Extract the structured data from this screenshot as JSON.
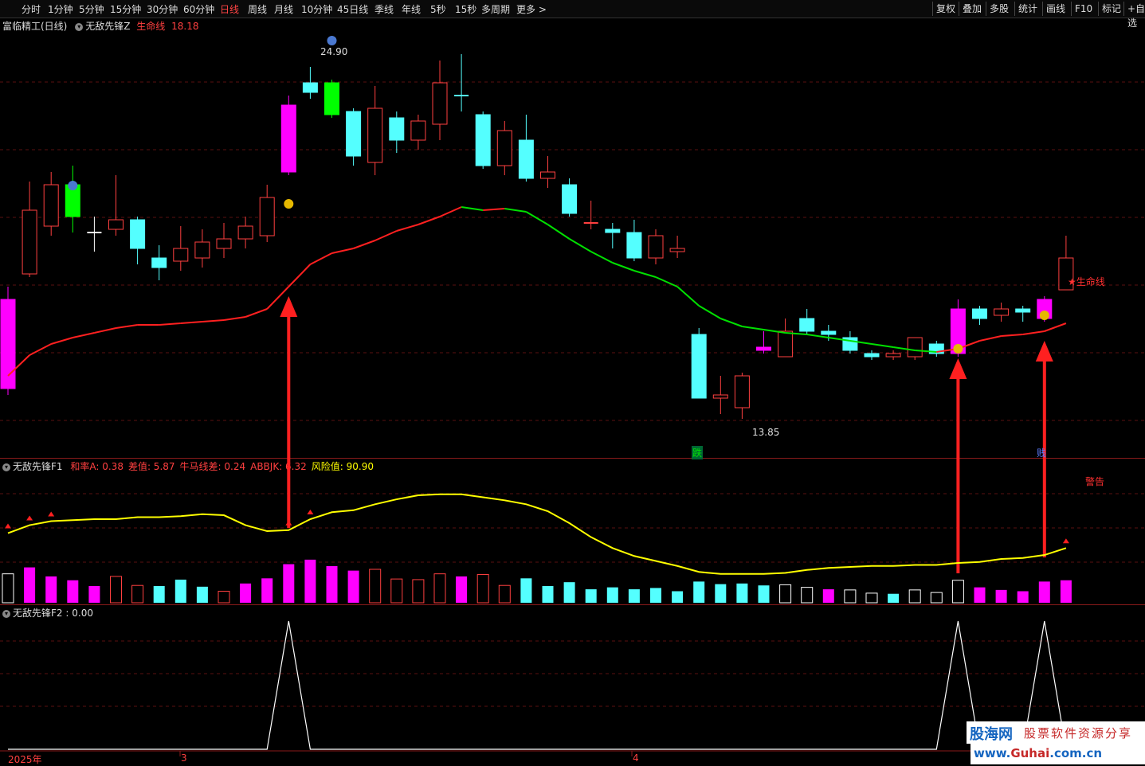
{
  "toolbar": {
    "periods": [
      "分时",
      "1分钟",
      "5分钟",
      "15分钟",
      "30分钟",
      "60分钟",
      "日线",
      "周线",
      "月线",
      "10分钟",
      "45日线",
      "季线",
      "年线",
      "5秒",
      "15秒",
      "多周期",
      "更多 >"
    ],
    "active_period": "日线",
    "right_buttons": [
      "复权",
      "叠加",
      "多股",
      "统计",
      "画线",
      "F10",
      "标记",
      "+自选"
    ]
  },
  "main_panel": {
    "stock_name": "富临精工(日线)",
    "indicator": "无敌先锋Z",
    "line_label": "生命线",
    "line_value": "18.18",
    "high_label": "24.90",
    "low_label": "13.85",
    "life_line_tag": "★生命线",
    "die_label": "跌",
    "jian_label": "贱",
    "warning_label": "警告"
  },
  "f1_panel": {
    "indicator": "无敌先锋F1",
    "items": [
      {
        "name": "和率A",
        "value": "0.38",
        "color": "#ff4040"
      },
      {
        "name": "差值",
        "value": "5.87",
        "color": "#ff4040"
      },
      {
        "name": "牛马线差",
        "value": "0.24",
        "color": "#ff4040"
      },
      {
        "name": "ABBJK",
        "value": "6.32",
        "color": "#ff4040"
      },
      {
        "name": "风险值",
        "value": "90.90",
        "color": "#ffff00"
      }
    ]
  },
  "f2_panel": {
    "indicator": "无敌先锋F2",
    "value": "0.00"
  },
  "x_axis": {
    "labels": [
      "2025年",
      "3",
      "4"
    ]
  },
  "watermark": {
    "site": "股海网",
    "slogan": "股票软件资源分享",
    "url_prefix": "www.",
    "url_main": "Guhai",
    "url_suffix": ".com.cn"
  },
  "colors": {
    "up": "#ff4040",
    "down": "#54ffff",
    "magenta": "#ff00ff",
    "green_candle": "#00ff00",
    "lifeline_up": "#ff2020",
    "lifeline_down": "#00e000",
    "yellow": "#ffff00"
  },
  "chart_data": {
    "type": "candlestick",
    "candles": [
      {
        "o": 14.8,
        "c": 17.6,
        "h": 18.0,
        "l": 14.6,
        "k": "magenta"
      },
      {
        "o": 18.4,
        "c": 20.4,
        "h": 21.3,
        "l": 18.3,
        "k": "up"
      },
      {
        "o": 19.9,
        "c": 21.2,
        "h": 21.6,
        "l": 19.6,
        "k": "up"
      },
      {
        "o": 21.2,
        "c": 20.2,
        "h": 21.8,
        "l": 19.7,
        "k": "green"
      },
      {
        "o": 19.7,
        "c": 19.7,
        "h": 20.2,
        "l": 19.1,
        "k": "doji"
      },
      {
        "o": 19.8,
        "c": 20.1,
        "h": 21.5,
        "l": 19.6,
        "k": "up"
      },
      {
        "o": 20.1,
        "c": 19.2,
        "h": 20.2,
        "l": 18.7,
        "k": "down"
      },
      {
        "o": 18.6,
        "c": 18.9,
        "h": 19.3,
        "l": 18.2,
        "k": "down"
      },
      {
        "o": 18.8,
        "c": 19.2,
        "h": 19.9,
        "l": 18.5,
        "k": "up"
      },
      {
        "o": 18.9,
        "c": 19.4,
        "h": 19.8,
        "l": 18.6,
        "k": "up"
      },
      {
        "o": 19.2,
        "c": 19.5,
        "h": 20.0,
        "l": 18.9,
        "k": "up"
      },
      {
        "o": 19.5,
        "c": 19.9,
        "h": 20.2,
        "l": 19.2,
        "k": "up"
      },
      {
        "o": 19.6,
        "c": 20.8,
        "h": 21.2,
        "l": 19.4,
        "k": "up"
      },
      {
        "o": 21.6,
        "c": 23.7,
        "h": 24.0,
        "l": 21.5,
        "k": "magenta"
      },
      {
        "o": 24.1,
        "c": 24.4,
        "h": 24.9,
        "l": 23.9,
        "k": "down"
      },
      {
        "o": 24.4,
        "c": 23.4,
        "h": 24.5,
        "l": 23.3,
        "k": "green"
      },
      {
        "o": 23.5,
        "c": 22.1,
        "h": 23.6,
        "l": 21.8,
        "k": "down"
      },
      {
        "o": 21.9,
        "c": 23.6,
        "h": 24.3,
        "l": 21.5,
        "k": "up"
      },
      {
        "o": 23.3,
        "c": 22.6,
        "h": 23.5,
        "l": 22.2,
        "k": "down"
      },
      {
        "o": 22.6,
        "c": 23.2,
        "h": 23.4,
        "l": 22.3,
        "k": "up"
      },
      {
        "o": 23.1,
        "c": 24.4,
        "h": 25.1,
        "l": 22.6,
        "k": "up"
      },
      {
        "o": 24.0,
        "c": 24.0,
        "h": 25.3,
        "l": 23.5,
        "k": "dojiC"
      },
      {
        "o": 23.4,
        "c": 21.8,
        "h": 23.5,
        "l": 21.7,
        "k": "down"
      },
      {
        "o": 21.8,
        "c": 22.9,
        "h": 23.2,
        "l": 21.5,
        "k": "up"
      },
      {
        "o": 22.6,
        "c": 21.4,
        "h": 23.4,
        "l": 21.3,
        "k": "down"
      },
      {
        "o": 21.4,
        "c": 21.6,
        "h": 22.1,
        "l": 21.1,
        "k": "up"
      },
      {
        "o": 21.2,
        "c": 20.3,
        "h": 21.4,
        "l": 20.2,
        "k": "down"
      },
      {
        "o": 20.0,
        "c": 20.0,
        "h": 20.7,
        "l": 19.8,
        "k": "dojiR"
      },
      {
        "o": 19.8,
        "c": 19.7,
        "h": 20.0,
        "l": 19.2,
        "k": "down"
      },
      {
        "o": 19.7,
        "c": 18.9,
        "h": 20.1,
        "l": 18.8,
        "k": "down"
      },
      {
        "o": 18.9,
        "c": 19.6,
        "h": 19.8,
        "l": 18.7,
        "k": "up"
      },
      {
        "o": 19.1,
        "c": 19.2,
        "h": 19.6,
        "l": 18.9,
        "k": "up"
      },
      {
        "o": 16.5,
        "c": 14.5,
        "h": 16.7,
        "l": 14.5,
        "k": "down"
      },
      {
        "o": 14.5,
        "c": 14.6,
        "h": 15.2,
        "l": 14.0,
        "k": "up"
      },
      {
        "o": 14.2,
        "c": 15.2,
        "h": 15.3,
        "l": 13.85,
        "k": "up"
      },
      {
        "o": 16.1,
        "c": 16.0,
        "h": 16.6,
        "l": 15.9,
        "k": "magenta"
      },
      {
        "o": 15.8,
        "c": 16.6,
        "h": 17.0,
        "l": 15.8,
        "k": "up"
      },
      {
        "o": 17.0,
        "c": 16.6,
        "h": 17.3,
        "l": 16.5,
        "k": "down"
      },
      {
        "o": 16.6,
        "c": 16.5,
        "h": 16.8,
        "l": 16.3,
        "k": "down"
      },
      {
        "o": 16.4,
        "c": 16.0,
        "h": 16.6,
        "l": 15.9,
        "k": "down"
      },
      {
        "o": 15.9,
        "c": 15.8,
        "h": 16.0,
        "l": 15.7,
        "k": "down"
      },
      {
        "o": 15.8,
        "c": 15.9,
        "h": 16.0,
        "l": 15.7,
        "k": "up"
      },
      {
        "o": 15.8,
        "c": 16.4,
        "h": 16.4,
        "l": 15.7,
        "k": "up"
      },
      {
        "o": 16.2,
        "c": 15.9,
        "h": 16.3,
        "l": 15.8,
        "k": "down"
      },
      {
        "o": 15.9,
        "c": 17.3,
        "h": 17.6,
        "l": 15.8,
        "k": "magenta"
      },
      {
        "o": 17.3,
        "c": 17.0,
        "h": 17.4,
        "l": 16.8,
        "k": "down"
      },
      {
        "o": 17.1,
        "c": 17.3,
        "h": 17.5,
        "l": 16.9,
        "k": "up"
      },
      {
        "o": 17.3,
        "c": 17.2,
        "h": 17.4,
        "l": 16.9,
        "k": "down"
      },
      {
        "o": 17.0,
        "c": 17.6,
        "h": 17.7,
        "l": 16.9,
        "k": "magenta"
      },
      {
        "o": 17.9,
        "c": 18.9,
        "h": 19.6,
        "l": 17.9,
        "k": "up"
      }
    ],
    "lifeline": [
      15.2,
      15.85,
      16.2,
      16.4,
      16.55,
      16.7,
      16.8,
      16.8,
      16.85,
      16.9,
      16.95,
      17.05,
      17.3,
      18.0,
      18.7,
      19.05,
      19.2,
      19.45,
      19.75,
      19.95,
      20.2,
      20.5,
      20.4,
      20.45,
      20.35,
      19.95,
      19.5,
      19.1,
      18.75,
      18.5,
      18.3,
      18.0,
      17.4,
      17.0,
      16.75,
      16.65,
      16.55,
      16.5,
      16.4,
      16.3,
      16.2,
      16.1,
      16.0,
      15.95,
      16.05,
      16.3,
      16.45,
      16.5,
      16.6,
      16.85
    ],
    "price_range": [
      13.0,
      26.0
    ],
    "f1_yellow": [
      0.7,
      0.78,
      0.82,
      0.83,
      0.84,
      0.84,
      0.86,
      0.86,
      0.87,
      0.89,
      0.88,
      0.78,
      0.72,
      0.73,
      0.84,
      0.91,
      0.93,
      0.99,
      1.04,
      1.08,
      1.09,
      1.09,
      1.06,
      1.03,
      0.99,
      0.92,
      0.8,
      0.66,
      0.55,
      0.47,
      0.42,
      0.37,
      0.31,
      0.29,
      0.29,
      0.29,
      0.3,
      0.33,
      0.35,
      0.36,
      0.37,
      0.37,
      0.38,
      0.38,
      0.4,
      0.41,
      0.44,
      0.45,
      0.48,
      0.55
    ],
    "f1_bars": [
      {
        "v": 0.4,
        "k": "hollowW"
      },
      {
        "v": 0.5,
        "k": "magenta"
      },
      {
        "v": 0.36,
        "k": "magenta"
      },
      {
        "v": 0.3,
        "k": "magenta"
      },
      {
        "v": 0.21,
        "k": "magenta"
      },
      {
        "v": 0.36,
        "k": "hollowR"
      },
      {
        "v": 0.22,
        "k": "hollowR"
      },
      {
        "v": 0.21,
        "k": "cyan"
      },
      {
        "v": 0.31,
        "k": "cyan"
      },
      {
        "v": 0.2,
        "k": "cyan"
      },
      {
        "v": 0.13,
        "k": "hollowR"
      },
      {
        "v": 0.25,
        "k": "magenta"
      },
      {
        "v": 0.33,
        "k": "magenta"
      },
      {
        "v": 0.55,
        "k": "magenta"
      },
      {
        "v": 0.62,
        "k": "magenta"
      },
      {
        "v": 0.52,
        "k": "magenta"
      },
      {
        "v": 0.45,
        "k": "magenta"
      },
      {
        "v": 0.47,
        "k": "hollowR"
      },
      {
        "v": 0.32,
        "k": "hollowR"
      },
      {
        "v": 0.31,
        "k": "hollowR"
      },
      {
        "v": 0.4,
        "k": "hollowR"
      },
      {
        "v": 0.36,
        "k": "magenta"
      },
      {
        "v": 0.39,
        "k": "hollowR"
      },
      {
        "v": 0.22,
        "k": "hollowR"
      },
      {
        "v": 0.33,
        "k": "cyan"
      },
      {
        "v": 0.21,
        "k": "cyan"
      },
      {
        "v": 0.27,
        "k": "cyan"
      },
      {
        "v": 0.16,
        "k": "cyan"
      },
      {
        "v": 0.19,
        "k": "cyan"
      },
      {
        "v": 0.16,
        "k": "cyan"
      },
      {
        "v": 0.18,
        "k": "cyan"
      },
      {
        "v": 0.13,
        "k": "cyan"
      },
      {
        "v": 0.28,
        "k": "cyan"
      },
      {
        "v": 0.24,
        "k": "cyan"
      },
      {
        "v": 0.25,
        "k": "cyan"
      },
      {
        "v": 0.22,
        "k": "cyan"
      },
      {
        "v": 0.23,
        "k": "hollowW"
      },
      {
        "v": 0.19,
        "k": "hollowW"
      },
      {
        "v": 0.16,
        "k": "magenta"
      },
      {
        "v": 0.15,
        "k": "hollowW"
      },
      {
        "v": 0.1,
        "k": "hollowW"
      },
      {
        "v": 0.09,
        "k": "cyan"
      },
      {
        "v": 0.15,
        "k": "hollowW"
      },
      {
        "v": 0.11,
        "k": "hollowW"
      },
      {
        "v": 0.3,
        "k": "hollowW"
      },
      {
        "v": 0.19,
        "k": "magenta"
      },
      {
        "v": 0.15,
        "k": "magenta"
      },
      {
        "v": 0.13,
        "k": "magenta"
      },
      {
        "v": 0.28,
        "k": "magenta"
      },
      {
        "v": 0.3,
        "k": "magenta"
      }
    ],
    "f2_spikes": [
      13,
      44,
      48
    ],
    "signal_arrows": [
      13,
      44,
      48
    ]
  }
}
